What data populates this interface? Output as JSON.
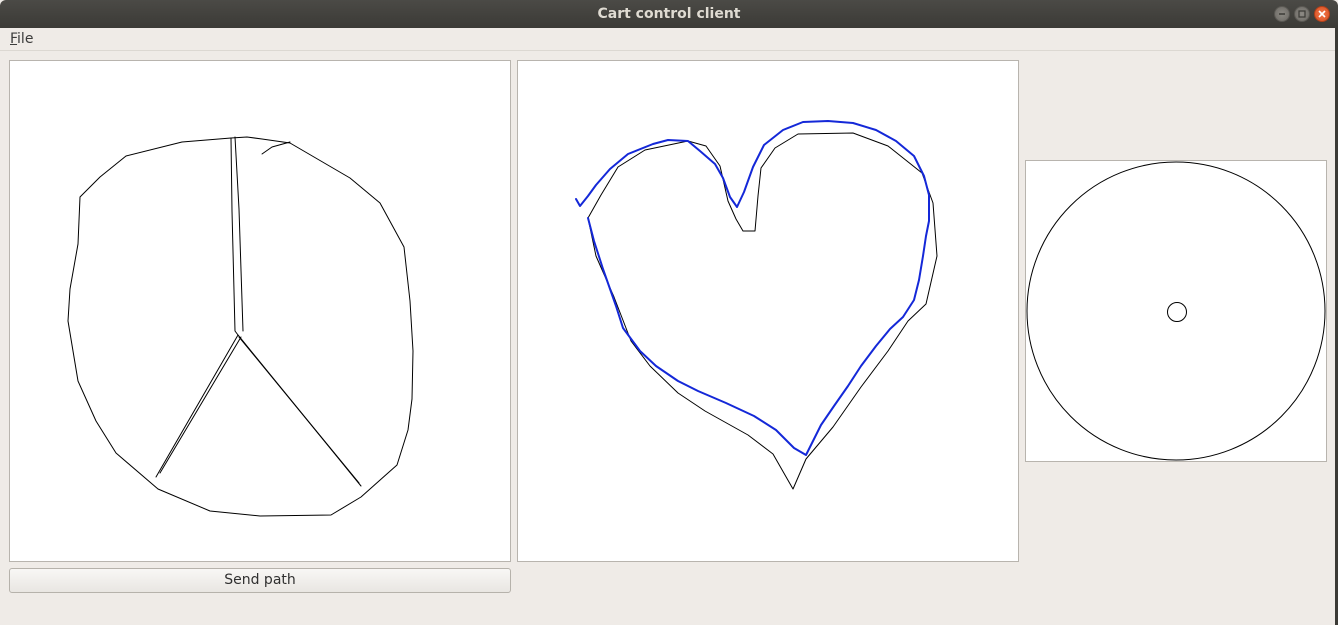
{
  "window": {
    "title": "Cart control client"
  },
  "menu": {
    "file_label": "File",
    "file_mnemonic": "F",
    "file_rest": "ile"
  },
  "controls": {
    "send_path_label": "Send path"
  },
  "colors": {
    "window_bg": "#efebe7",
    "canvas_bg": "#ffffff",
    "drawn_path": "#000000",
    "tracked_path": "#1428d8",
    "close_button": "#e95420"
  },
  "canvases": {
    "left": {
      "content": "peace sign drawing",
      "stroke": "black"
    },
    "middle": {
      "content": "heart drawing with tracked path overlay",
      "stroke": "black",
      "overlay_stroke": "blue"
    },
    "right": {
      "content": "joystick circle with center handle",
      "stroke": "black"
    }
  }
}
